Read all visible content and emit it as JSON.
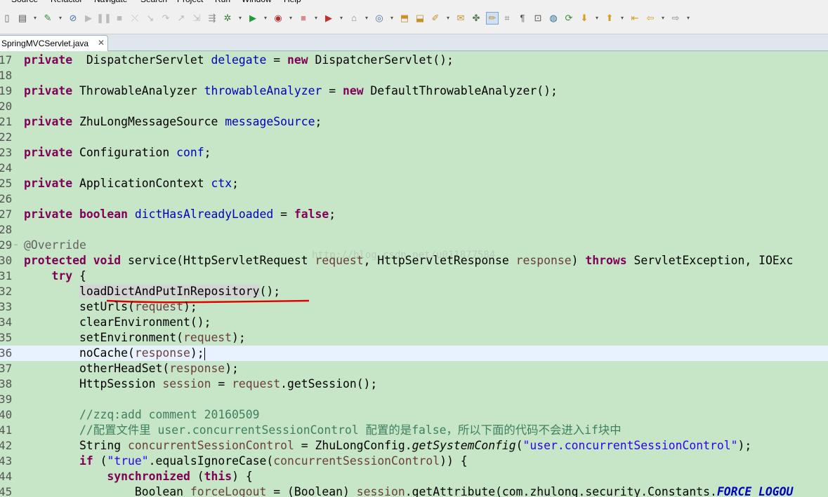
{
  "menu": [
    "Source",
    "Refactor",
    "Navigate",
    "Search",
    "Project",
    "Run",
    "Window",
    "Help"
  ],
  "toolbar": {
    "icons": [
      "new-icon",
      "save-icon",
      "dropdown-icon",
      "build-icon",
      "dropdown-icon",
      "skip-breakpoints-icon",
      "resume-icon",
      "suspend-icon",
      "terminate-icon",
      "disconnect-icon",
      "step-into-icon",
      "step-over-icon",
      "step-return-icon",
      "drop-to-frame-icon",
      "use-step-filters-icon",
      "debug-icon",
      "dropdown-icon",
      "run-icon",
      "dropdown-icon",
      "coverage-icon",
      "dropdown-icon",
      "stop-icon",
      "dropdown-icon",
      "external-tools-icon",
      "dropdown-icon",
      "new-java-project-icon",
      "dropdown-icon",
      "new-class-icon",
      "dropdown-icon",
      "open-type-icon",
      "open-resource-icon",
      "search-icon",
      "dropdown-icon",
      "open-task-icon",
      "toggle-mark-occurrences-icon",
      "toggle-highlight-icon",
      "block-selection-icon",
      "show-whitespace-icon",
      "pin-editor-icon",
      "globe-icon",
      "refresh-icon",
      "next-annotation-icon",
      "dropdown-icon",
      "previous-annotation-icon",
      "dropdown-icon",
      "last-edit-icon",
      "back-icon",
      "dropdown-icon",
      "forward-icon",
      "dropdown-icon"
    ]
  },
  "tab": {
    "label": "SpringMVCServlet.java",
    "close": "✕"
  },
  "watermark": "http://blog.csdn.net/u011877584",
  "editor": {
    "current_line": 36,
    "lines": [
      {
        "n": "17",
        "t": [
          [
            "kw",
            "private"
          ],
          [
            "",
            "  DispatcherServlet "
          ],
          [
            "fld",
            "delegate"
          ],
          [
            "",
            " = "
          ],
          [
            "kw",
            "new"
          ],
          [
            "",
            " DispatcherServlet();"
          ]
        ]
      },
      {
        "n": "18",
        "t": []
      },
      {
        "n": "19",
        "t": [
          [
            "kw",
            "private"
          ],
          [
            "",
            " ThrowableAnalyzer "
          ],
          [
            "fld",
            "throwableAnalyzer"
          ],
          [
            "",
            " = "
          ],
          [
            "kw",
            "new"
          ],
          [
            "",
            " DefaultThrowableAnalyzer();"
          ]
        ]
      },
      {
        "n": "20",
        "t": []
      },
      {
        "n": "21",
        "t": [
          [
            "kw",
            "private"
          ],
          [
            "",
            " ZhuLongMessageSource "
          ],
          [
            "fld",
            "messageSource"
          ],
          [
            "",
            ";"
          ]
        ]
      },
      {
        "n": "22",
        "t": []
      },
      {
        "n": "23",
        "t": [
          [
            "kw",
            "private"
          ],
          [
            "",
            " Configuration "
          ],
          [
            "fld",
            "conf"
          ],
          [
            "",
            ";"
          ]
        ]
      },
      {
        "n": "24",
        "t": []
      },
      {
        "n": "25",
        "t": [
          [
            "kw",
            "private"
          ],
          [
            "",
            " ApplicationContext "
          ],
          [
            "fld",
            "ctx"
          ],
          [
            "",
            ";"
          ]
        ]
      },
      {
        "n": "26",
        "t": []
      },
      {
        "n": "27",
        "t": [
          [
            "kw",
            "private"
          ],
          [
            "kw",
            " boolean"
          ],
          [
            "",
            ""
          ],
          [
            "",
            " "
          ],
          [
            "fld",
            "dictHasAlreadyLoaded"
          ],
          [
            "",
            " = "
          ],
          [
            "kw",
            "false"
          ],
          [
            "",
            ";"
          ]
        ]
      },
      {
        "n": "28",
        "t": []
      },
      {
        "n": "29",
        "fold": "−",
        "t": [
          [
            "ann",
            "@Override"
          ]
        ]
      },
      {
        "n": "30",
        "t": [
          [
            "kw",
            "protected"
          ],
          [
            "",
            " "
          ],
          [
            "kw",
            "void"
          ],
          [
            "",
            " service(HttpServletRequest "
          ],
          [
            "prm",
            "request"
          ],
          [
            "",
            ", HttpServletResponse "
          ],
          [
            "prm",
            "response"
          ],
          [
            "",
            ") "
          ],
          [
            "kw",
            "throws"
          ],
          [
            "",
            " ServletException, IOExc"
          ]
        ]
      },
      {
        "n": "31",
        "t": [
          [
            "",
            "    "
          ],
          [
            "kw",
            "try"
          ],
          [
            "",
            " {"
          ]
        ]
      },
      {
        "n": "32",
        "t": [
          [
            "",
            "        "
          ],
          [
            "hl",
            "loadDictAndPutInRepository"
          ],
          [
            "",
            "();"
          ]
        ]
      },
      {
        "n": "33",
        "t": [
          [
            "",
            "        setUrls("
          ],
          [
            "prm",
            "request"
          ],
          [
            "",
            ");"
          ]
        ]
      },
      {
        "n": "34",
        "t": [
          [
            "",
            "        clearEnvironment();"
          ]
        ]
      },
      {
        "n": "35",
        "t": [
          [
            "",
            "        setEnvironment("
          ],
          [
            "prm",
            "request"
          ],
          [
            "",
            ");"
          ]
        ]
      },
      {
        "n": "36",
        "t": [
          [
            "",
            "        noCache("
          ],
          [
            "prm",
            "response"
          ],
          [
            "",
            ");"
          ],
          [
            "caret",
            ""
          ]
        ]
      },
      {
        "n": "37",
        "t": [
          [
            "",
            "        otherHeadSet("
          ],
          [
            "prm",
            "response"
          ],
          [
            "",
            ");"
          ]
        ]
      },
      {
        "n": "38",
        "t": [
          [
            "",
            "        HttpSession "
          ],
          [
            "prm",
            "session"
          ],
          [
            "",
            " = "
          ],
          [
            "prm",
            "request"
          ],
          [
            "",
            ".getSession();"
          ]
        ]
      },
      {
        "n": "39",
        "t": []
      },
      {
        "n": "40",
        "t": [
          [
            "",
            "        "
          ],
          [
            "cmt",
            "//zzq:add comment 20160509"
          ]
        ]
      },
      {
        "n": "41",
        "t": [
          [
            "",
            "        "
          ],
          [
            "cmt",
            "//配置文件里 user.concurrentSessionControl 配置的是false，所以下面的代码不会进入if块中"
          ]
        ]
      },
      {
        "n": "42",
        "t": [
          [
            "",
            "        String "
          ],
          [
            "prm",
            "concurrentSessionControl"
          ],
          [
            "",
            " = ZhuLongConfig."
          ],
          [
            "ita",
            "getSystemConfig"
          ],
          [
            "",
            "("
          ],
          [
            "str",
            "\"user.concurrentSessionControl\""
          ],
          [
            "",
            ");"
          ]
        ]
      },
      {
        "n": "43",
        "t": [
          [
            "",
            "        "
          ],
          [
            "kw",
            "if"
          ],
          [
            "",
            " ("
          ],
          [
            "str",
            "\"true\""
          ],
          [
            "",
            ".equalsIgnoreCase("
          ],
          [
            "prm",
            "concurrentSessionControl"
          ],
          [
            "",
            ")) {"
          ]
        ]
      },
      {
        "n": "44",
        "t": [
          [
            "",
            "            "
          ],
          [
            "kw",
            "synchronized"
          ],
          [
            "",
            " ("
          ],
          [
            "kw",
            "this"
          ],
          [
            "",
            ") {"
          ]
        ]
      },
      {
        "n": "45",
        "t": [
          [
            "",
            "                Boolean "
          ],
          [
            "prm",
            "forceLogout"
          ],
          [
            "",
            " = (Boolean) "
          ],
          [
            "prm",
            "session"
          ],
          [
            "",
            ".getAttribute(com.zhulong.security.Constants."
          ],
          [
            "sfld",
            "FORCE_LOGOU"
          ]
        ]
      }
    ]
  }
}
